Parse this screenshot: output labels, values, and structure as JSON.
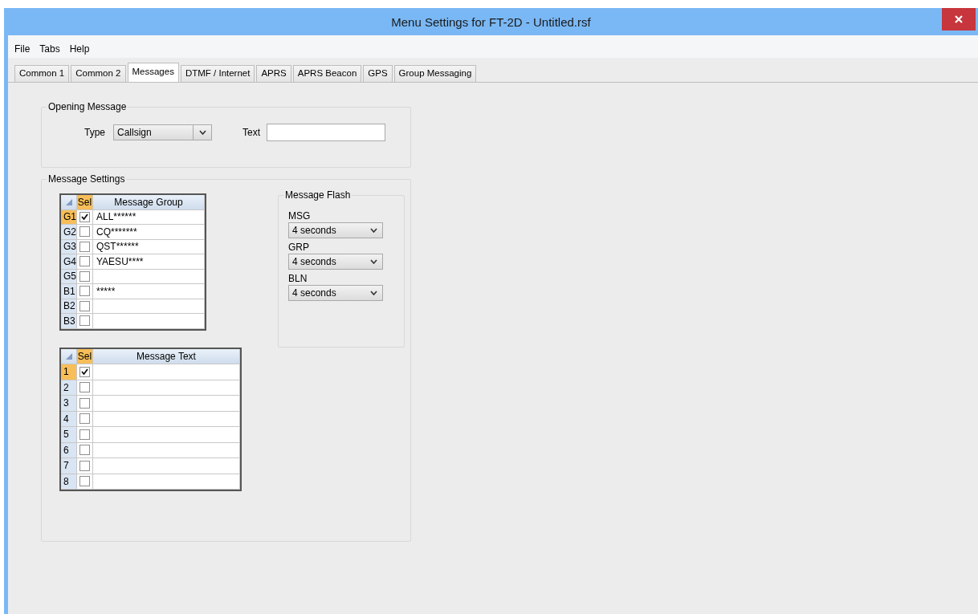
{
  "window": {
    "title": "Menu Settings for FT-2D - Untitled.rsf"
  },
  "menu": [
    {
      "label": "File"
    },
    {
      "label": "Tabs"
    },
    {
      "label": "Help"
    }
  ],
  "tabs": [
    {
      "label": "Common 1",
      "selected": false
    },
    {
      "label": "Common 2",
      "selected": false
    },
    {
      "label": "Messages",
      "selected": true
    },
    {
      "label": "DTMF / Internet",
      "selected": false
    },
    {
      "label": "APRS",
      "selected": false
    },
    {
      "label": "APRS Beacon",
      "selected": false
    },
    {
      "label": "GPS",
      "selected": false
    },
    {
      "label": "Group Messaging",
      "selected": false
    }
  ],
  "opening_message": {
    "title": "Opening Message",
    "type_label": "Type",
    "type_value": "Callsign",
    "text_label": "Text"
  },
  "message_settings": {
    "title": "Message Settings",
    "group_table": {
      "columns": [
        {
          "label": "Sel",
          "selected": true
        },
        {
          "label": "Message Group",
          "selected": false
        }
      ],
      "rows": [
        {
          "header": "G1",
          "checked": true,
          "selected": true,
          "value": "ALL******"
        },
        {
          "header": "G2",
          "checked": false,
          "selected": false,
          "value": "CQ*******"
        },
        {
          "header": "G3",
          "checked": false,
          "selected": false,
          "value": "QST******"
        },
        {
          "header": "G4",
          "checked": false,
          "selected": false,
          "value": "YAESU****"
        },
        {
          "header": "G5",
          "checked": false,
          "selected": false
        },
        {
          "header": "B1",
          "checked": false,
          "selected": false,
          "value": "*****"
        },
        {
          "header": "B2",
          "checked": false,
          "selected": false
        },
        {
          "header": "B3",
          "checked": false,
          "selected": false
        }
      ]
    },
    "message_flash": {
      "title": "Message Flash",
      "items": [
        {
          "label": "MSG",
          "value": "4 seconds"
        },
        {
          "label": "GRP",
          "value": "4 seconds"
        },
        {
          "label": "BLN",
          "value": "4 seconds"
        }
      ]
    },
    "text_table": {
      "columns": [
        {
          "label": "Sel",
          "selected": true
        },
        {
          "label": "Message Text",
          "selected": false
        }
      ],
      "rows": [
        {
          "header": "1",
          "checked": true,
          "selected": true
        },
        {
          "header": "2",
          "checked": false,
          "selected": false
        },
        {
          "header": "3",
          "checked": false,
          "selected": false
        },
        {
          "header": "4",
          "checked": false,
          "selected": false
        },
        {
          "header": "5",
          "checked": false,
          "selected": false
        },
        {
          "header": "6",
          "checked": false,
          "selected": false
        },
        {
          "header": "7",
          "checked": false,
          "selected": false
        },
        {
          "header": "8",
          "checked": false,
          "selected": false
        }
      ]
    }
  }
}
